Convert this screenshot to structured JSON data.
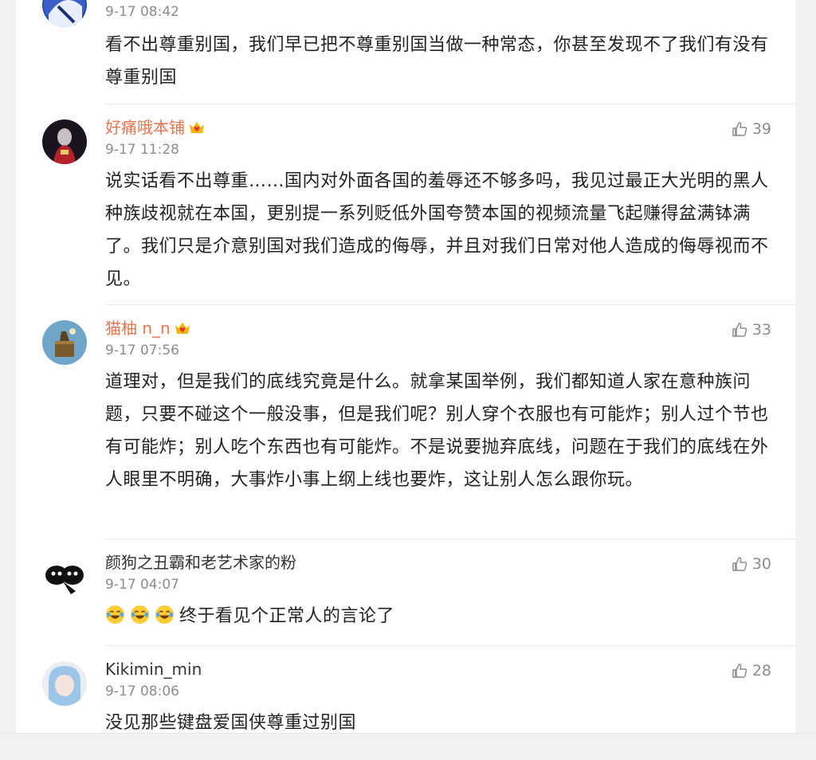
{
  "comments": [
    {
      "author": "",
      "time": "9-17 08:42",
      "likes": "",
      "text": "看不出尊重别国，我们早已把不尊重别国当做一种常态，你甚至发现不了我们有没有尊重别国"
    },
    {
      "author": "好痛哦本铺",
      "time": "9-17 11:28",
      "likes": "39",
      "text": "说实话看不出尊重……国内对外面各国的羞辱还不够多吗，我见过最正大光明的黑人种族歧视就在本国，更别提一系列贬低外国夸赞本国的视频流量飞起赚得盆满钵满了。我们只是介意别国对我们造成的侮辱，并且对我们日常对他人造成的侮辱视而不见。"
    },
    {
      "author": "猫柚 n_n",
      "time": "9-17 07:56",
      "likes": "33",
      "text": "道理对，但是我们的底线究竟是什么。就拿某国举例，我们都知道人家在意种族问题，只要不碰这个一般没事，但是我们呢？别人穿个衣服也有可能炸；别人过个节也有可能炸；别人吃个东西也有可能炸。不是说要抛弃底线，问题在于我们的底线在外人眼里不明确，大事炸小事上纲上线也要炸，这让别人怎么跟你玩。"
    },
    {
      "author": "颜狗之丑霸和老艺术家的粉",
      "time": "9-17 04:07",
      "likes": "30",
      "text": "终于看见个正常人的言论了"
    },
    {
      "author": "Kikimin_min",
      "time": "9-17 08:06",
      "likes": "28",
      "text": "没见那些键盘爱国侠尊重过别国"
    }
  ],
  "colors": {
    "author_highlight": "#eb7350",
    "author_plain": "#333333",
    "meta": "#8c8c8c",
    "text": "#222222"
  },
  "icons": {
    "like": "thumbs-up-icon",
    "crown": "crown-heart-badge-icon",
    "emoji": "laugh-cry-emoji-icon"
  }
}
